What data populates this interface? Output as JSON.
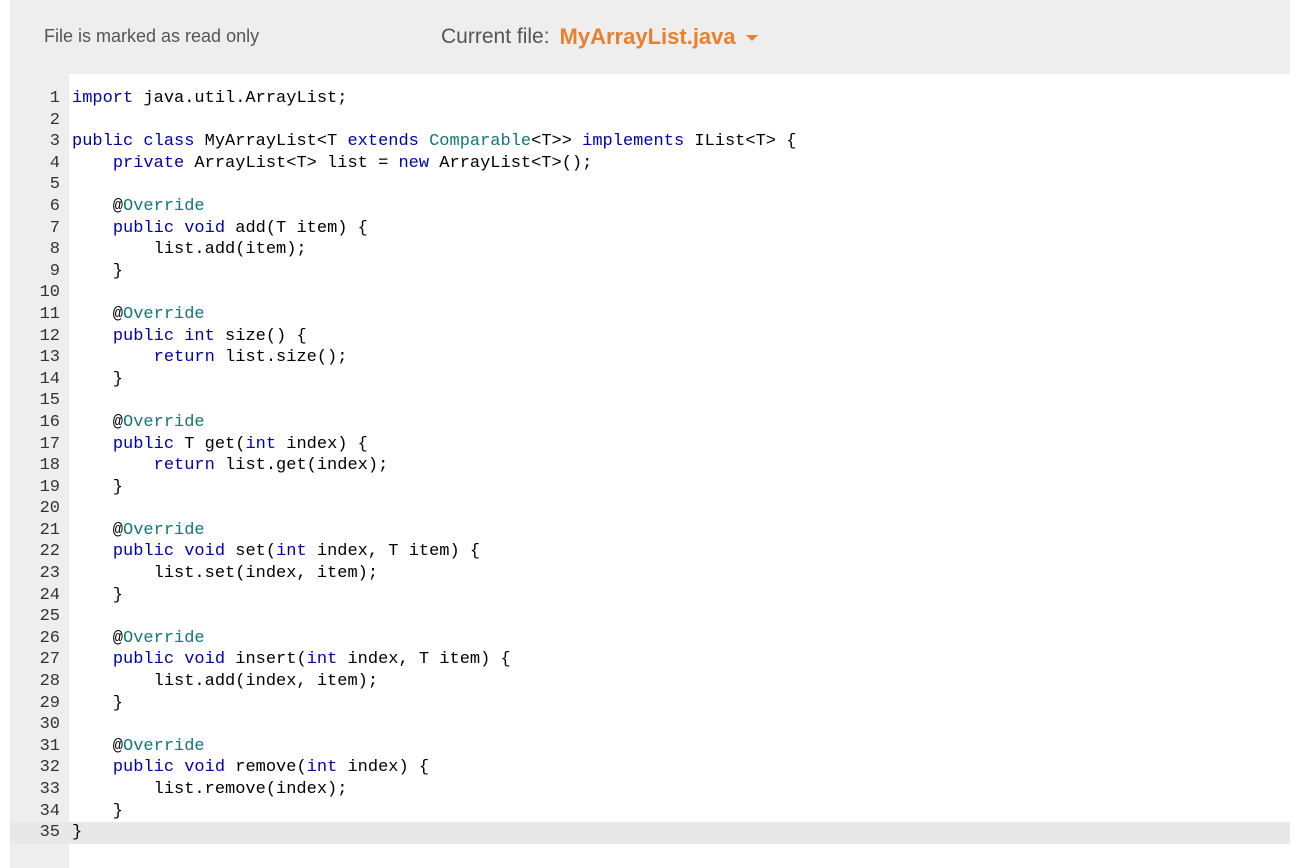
{
  "header": {
    "readonly_text": "File is marked as read only",
    "current_label": "Current file:",
    "current_file": "MyArrayList.java"
  },
  "colors": {
    "accent": "#e8812e",
    "header_bg": "#eeeeee",
    "keyword": "#0000aa",
    "annotation": "#117777"
  },
  "editor": {
    "language": "java",
    "active_line": 35,
    "lines": [
      "import java.util.ArrayList;",
      "",
      "public class MyArrayList<T extends Comparable<T>> implements IList<T> {",
      "    private ArrayList<T> list = new ArrayList<T>();",
      "",
      "    @Override",
      "    public void add(T item) {",
      "        list.add(item);",
      "    }",
      "",
      "    @Override",
      "    public int size() {",
      "        return list.size();",
      "    }",
      "",
      "    @Override",
      "    public T get(int index) {",
      "        return list.get(index);",
      "    }",
      "",
      "    @Override",
      "    public void set(int index, T item) {",
      "        list.set(index, item);",
      "    }",
      "",
      "    @Override",
      "    public void insert(int index, T item) {",
      "        list.add(index, item);",
      "    }",
      "",
      "    @Override",
      "    public void remove(int index) {",
      "        list.remove(index);",
      "    }",
      "}"
    ]
  }
}
